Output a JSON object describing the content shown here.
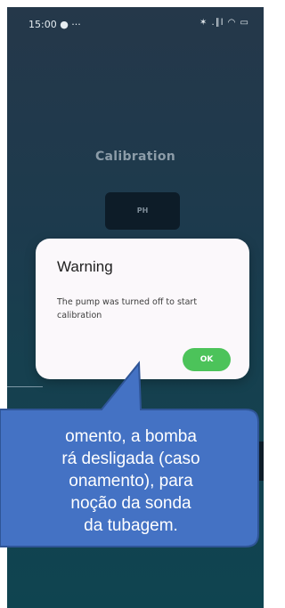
{
  "status_bar": {
    "time": "15:00 ● ···",
    "icons": "✶ .∥l ◠ ▭"
  },
  "screen": {
    "title": "Calibration",
    "ph_button": "PH"
  },
  "dialog": {
    "title": "Warning",
    "message": "The pump was turned off to start calibration",
    "ok_label": "OK"
  },
  "callout": {
    "lines": [
      "omento, a bomba",
      "rá desligada (caso",
      "onamento), para",
      "noção da sonda",
      "da tubagem."
    ]
  },
  "colors": {
    "accent_ok": "#4cc35a",
    "callout_fill": "#4472c4",
    "callout_border": "#2f5597"
  }
}
